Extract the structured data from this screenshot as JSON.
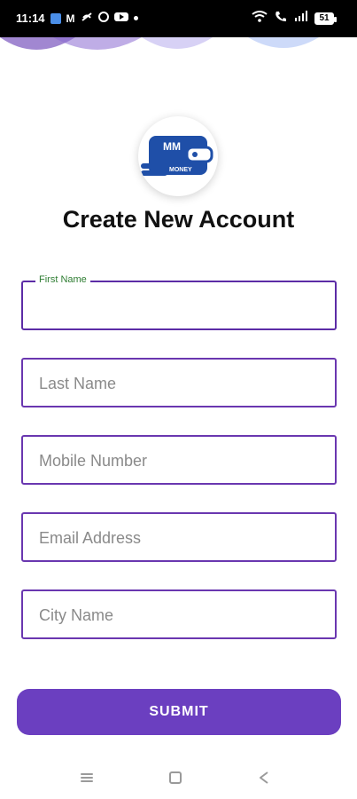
{
  "status_bar": {
    "time": "11:14",
    "battery": "51",
    "icons": [
      "chat-icon",
      "gmail-icon",
      "mute-icon",
      "opera-icon",
      "youtube-icon",
      "dot-icon",
      "wifi-icon",
      "call-icon",
      "signal-icon",
      "battery-icon"
    ]
  },
  "brand": {
    "logo_text_top": "MM",
    "logo_text_bottom": "MONEY",
    "accent": "#6b3fc0",
    "field_border": "#5c2ca6",
    "focus_label_color": "#2e7d32"
  },
  "page": {
    "title": "Create New Account"
  },
  "form": {
    "first_name": {
      "label": "First Name",
      "placeholder": ""
    },
    "last_name": {
      "placeholder": "Last Name"
    },
    "mobile": {
      "placeholder": "Mobile Number"
    },
    "email": {
      "placeholder": "Email Address"
    },
    "city": {
      "placeholder": "City Name"
    },
    "submit_label": "SUBMIT"
  },
  "nav": {
    "icons": [
      "menu-icon",
      "home-icon",
      "back-icon"
    ]
  }
}
